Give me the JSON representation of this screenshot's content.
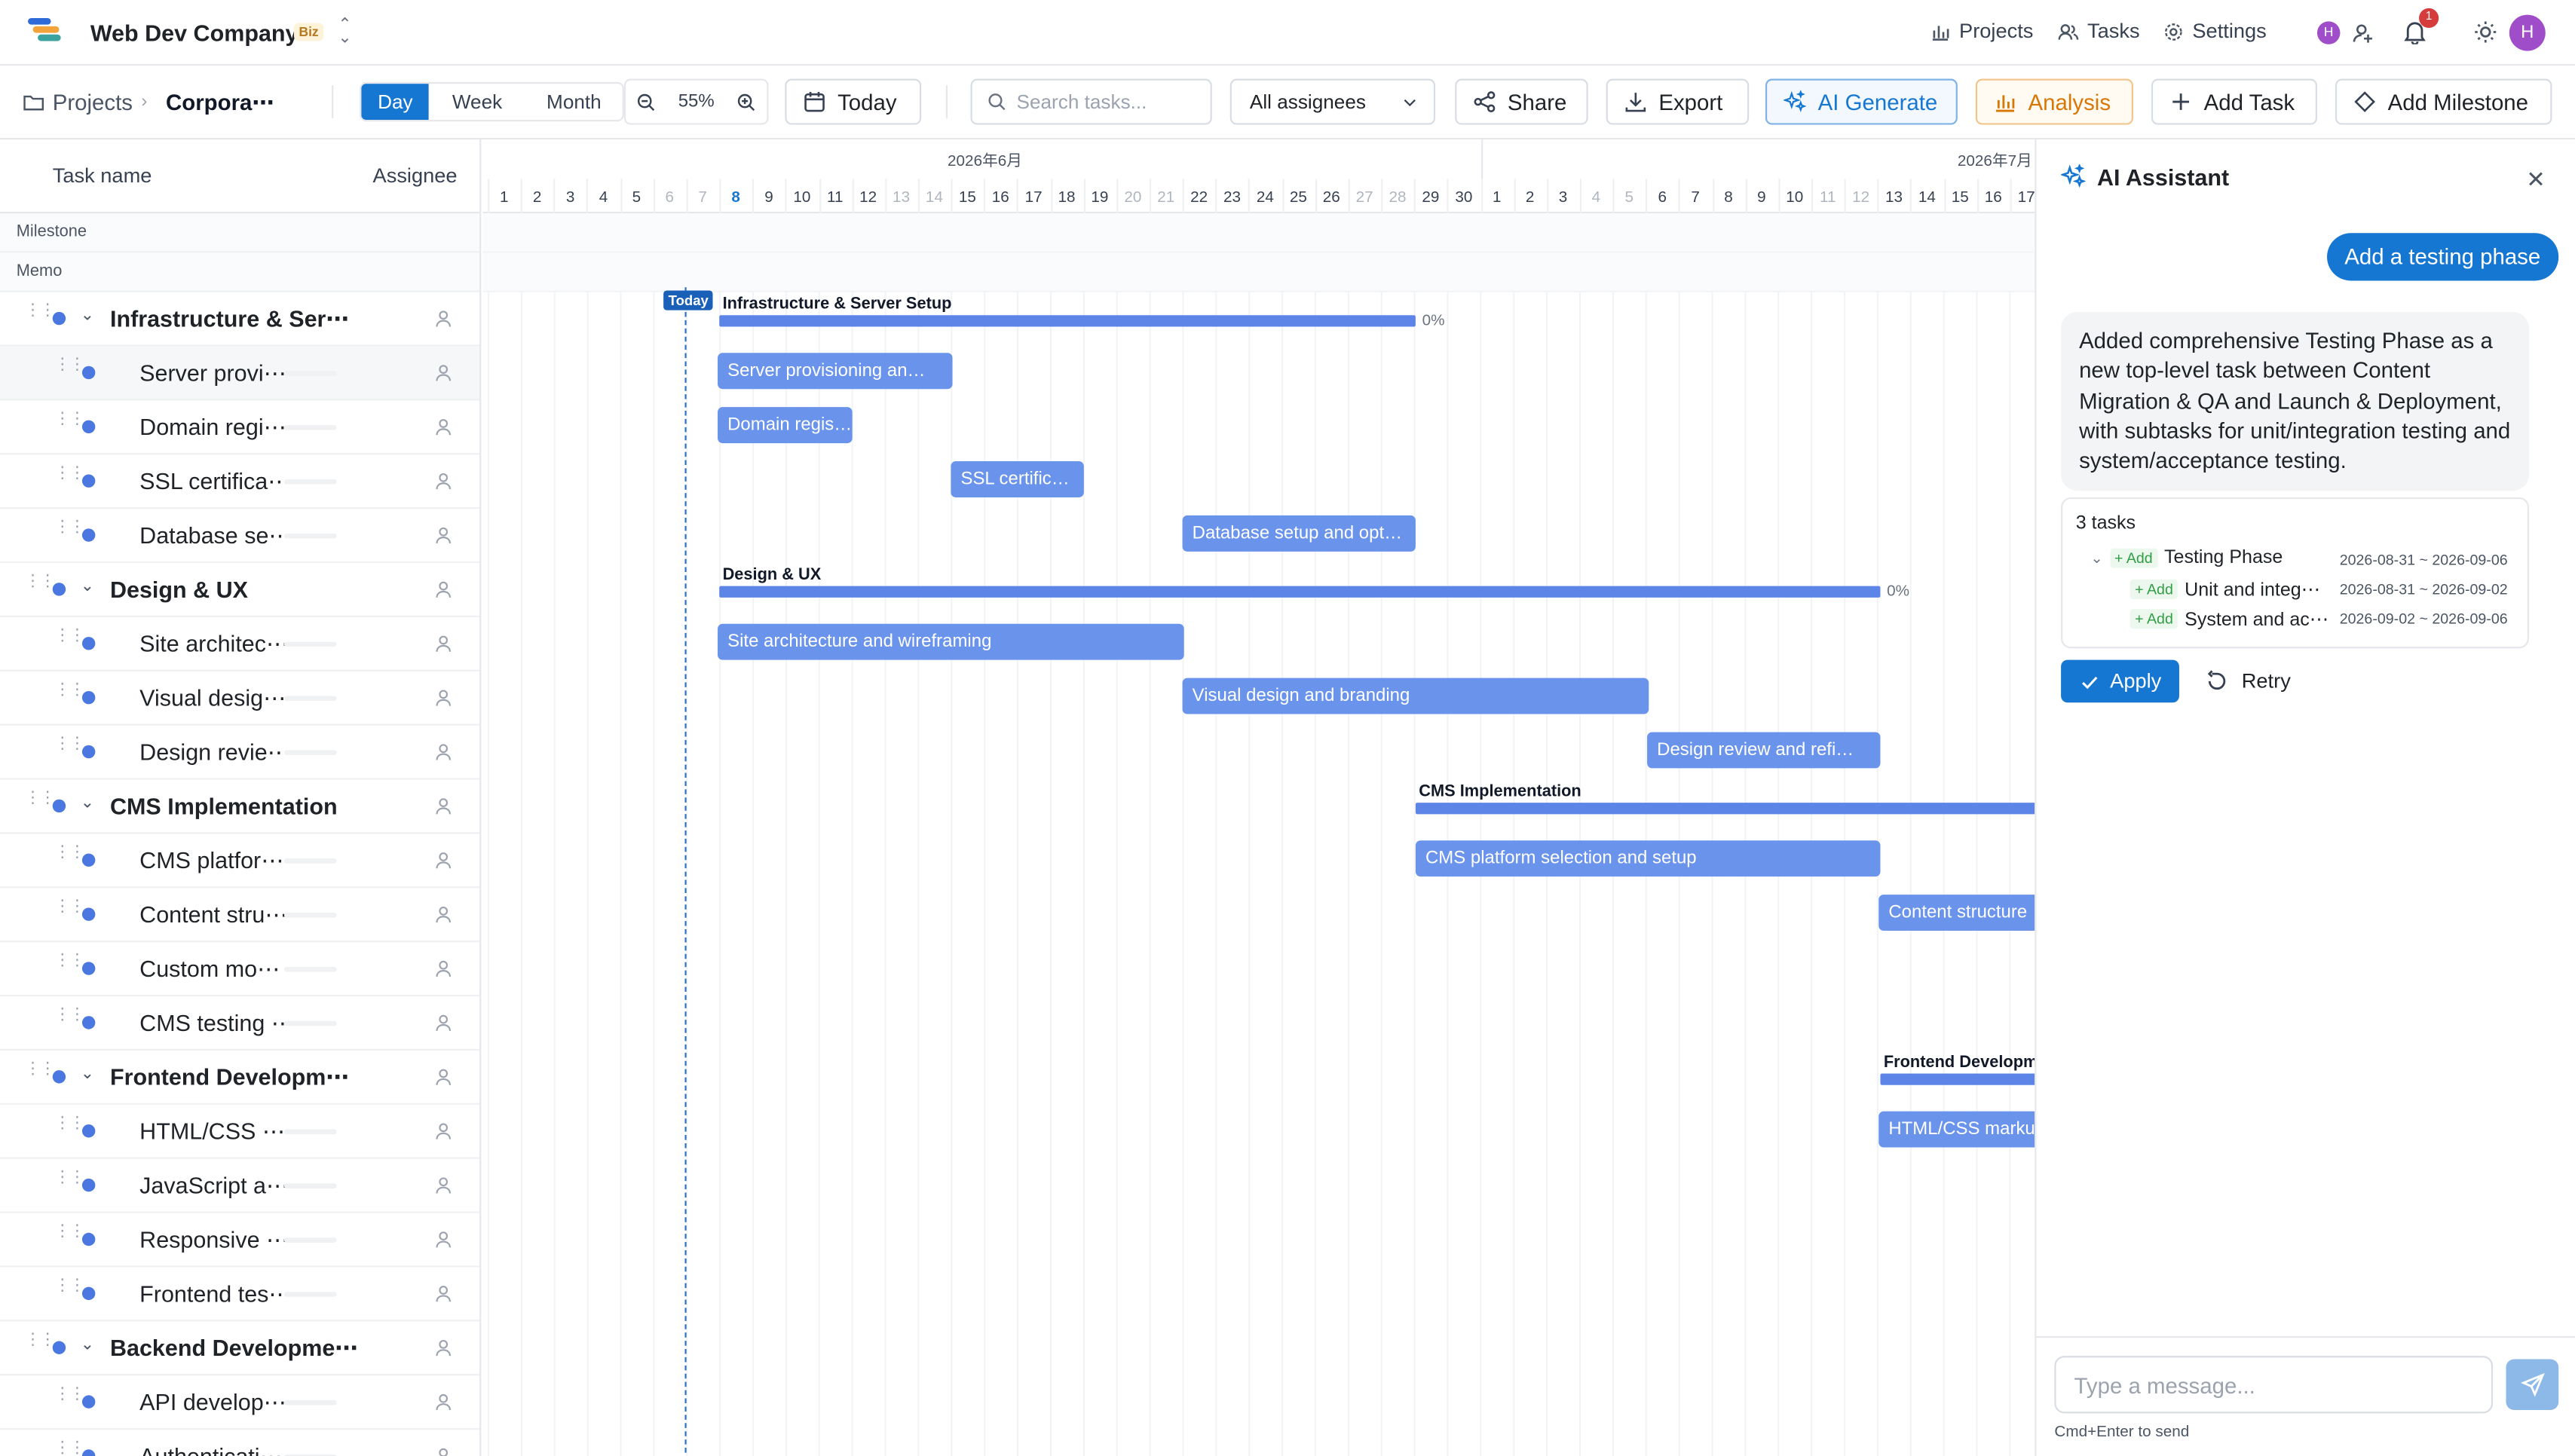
{
  "nav": {
    "company": "Web Dev Company",
    "plan_badge": "Biz",
    "links": [
      {
        "label": "Projects",
        "icon": "chart-icon"
      },
      {
        "label": "Tasks",
        "icon": "users-icon"
      },
      {
        "label": "Settings",
        "icon": "gear-icon"
      }
    ],
    "small_avatar": "H",
    "notification_count": "1",
    "avatar": "H"
  },
  "toolbar": {
    "breadcrumb_root": "Projects",
    "breadcrumb_current": "Corpora⋯",
    "views": [
      "Day",
      "Week",
      "Month"
    ],
    "active_view": "Day",
    "zoom": "55%",
    "today": "Today",
    "search_placeholder": "Search tasks...",
    "assignee_filter": "All assignees",
    "share": "Share",
    "export": "Export",
    "ai_generate": "AI Generate",
    "analysis": "Analysis",
    "add_task": "Add Task",
    "add_milestone": "Add Milestone"
  },
  "tasklist": {
    "col_task": "Task name",
    "col_assignee": "Assignee",
    "milestone_label": "Milestone",
    "memo_label": "Memo",
    "rows": [
      {
        "name": "Infrastructure & Ser⋯",
        "parent": true
      },
      {
        "name": "Server provi⋯",
        "parent": false
      },
      {
        "name": "Domain regi⋯",
        "parent": false
      },
      {
        "name": "SSL certifica⋯",
        "parent": false
      },
      {
        "name": "Database se⋯",
        "parent": false
      },
      {
        "name": "Design & UX",
        "parent": true
      },
      {
        "name": "Site architec⋯",
        "parent": false
      },
      {
        "name": "Visual desig⋯",
        "parent": false
      },
      {
        "name": "Design revie⋯",
        "parent": false
      },
      {
        "name": "CMS Implementation",
        "parent": true
      },
      {
        "name": "CMS platfor⋯",
        "parent": false
      },
      {
        "name": "Content stru⋯",
        "parent": false
      },
      {
        "name": "Custom mo⋯",
        "parent": false
      },
      {
        "name": "CMS testing ⋯",
        "parent": false
      },
      {
        "name": "Frontend Developm⋯",
        "parent": true
      },
      {
        "name": "HTML/CSS ⋯",
        "parent": false
      },
      {
        "name": "JavaScript a⋯",
        "parent": false
      },
      {
        "name": "Responsive ⋯",
        "parent": false
      },
      {
        "name": "Frontend tes⋯",
        "parent": false
      },
      {
        "name": "Backend Developme⋯",
        "parent": true
      },
      {
        "name": "API develop⋯",
        "parent": false
      },
      {
        "name": "Authenticati⋯",
        "parent": false
      }
    ]
  },
  "gantt": {
    "months": [
      "2026年6月",
      "2026年7月"
    ],
    "days": [
      1,
      2,
      3,
      4,
      5,
      6,
      7,
      8,
      9,
      10,
      11,
      12,
      13,
      14,
      15,
      16,
      17,
      18,
      19,
      20,
      21,
      22,
      23,
      24,
      25,
      26,
      27,
      28,
      29,
      30,
      1,
      2,
      3,
      4,
      5,
      6,
      7,
      8,
      9,
      10,
      11,
      12,
      13,
      14,
      15,
      16,
      17
    ],
    "today_label": "Today",
    "parents": [
      {
        "title": "Infrastructure & Server Setup",
        "pct": "0%"
      },
      {
        "title": "Design & UX",
        "pct": "0%"
      },
      {
        "title": "CMS Implementation",
        "pct": ""
      },
      {
        "title": "Frontend Developme",
        "pct": ""
      }
    ],
    "bars": [
      "Server provisioning an…",
      "Domain regis…",
      "SSL certific…",
      "Database setup and opt…",
      "Site architecture and wireframing",
      "Visual design and branding",
      "Design review and refi…",
      "CMS platform selection and setup",
      "Content structure",
      "HTML/CSS markup"
    ]
  },
  "ai": {
    "title": "AI Assistant",
    "user_message": "Add a testing phase",
    "reply": "Added comprehensive Testing Phase as a new top-level task between Content Migration & QA and Launch & Deployment, with subtasks for unit/integration testing and system/acceptance testing.",
    "task_count": "3 tasks",
    "tasks": [
      {
        "tag": "+ Add",
        "name": "Testing Phase",
        "dates": "2026-08-31 ~ 2026-09-06"
      },
      {
        "tag": "+ Add",
        "name": "Unit and integ⋯",
        "dates": "2026-08-31 ~ 2026-09-02"
      },
      {
        "tag": "+ Add",
        "name": "System and ac⋯",
        "dates": "2026-09-02 ~ 2026-09-06"
      }
    ],
    "apply": "Apply",
    "retry": "Retry",
    "input_placeholder": "Type a message...",
    "hint": "Cmd+Enter to send"
  },
  "colors": {
    "accent": "#1677d2",
    "bar": "#6a93ec",
    "analysis": "#d97706",
    "avatar": "#a04dc9"
  }
}
